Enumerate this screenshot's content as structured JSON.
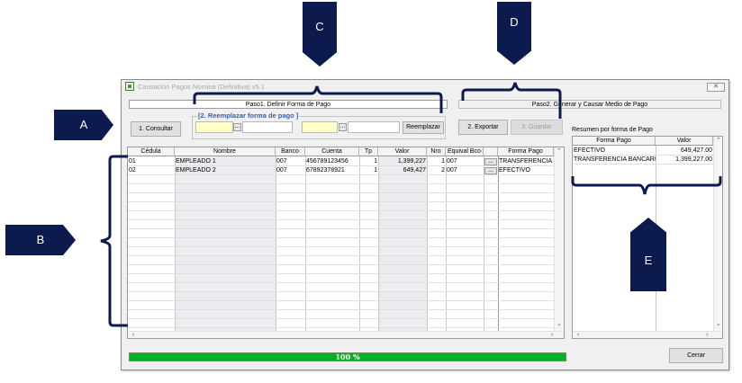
{
  "window": {
    "title": "Causación Pagos Nomina (Definitiva) v5.1",
    "close_label": "✕"
  },
  "panel1": {
    "title": "Paso1. Definir Forma de Pago",
    "consult_button": "1. Consultar",
    "group_label": "[2. Reemplazar forma de pago ]",
    "dots_label": "...",
    "replace_button": "Reemplazar"
  },
  "panel2": {
    "title": "Paso2. Generar y Causar Medio de Pago",
    "export_button": "2. Exportar",
    "save_button": "3. Guardar",
    "summary_label": "Resumen por forma de Pago"
  },
  "main_grid": {
    "columns": [
      "Cédula",
      "Nombre",
      "Banco",
      "Cuenta",
      "Tp",
      "Valor",
      "Nro",
      "Equival Bco",
      "",
      "Forma Pago"
    ],
    "rows": [
      {
        "cedula": "01",
        "nombre": "EMPLEADO 1",
        "banco": "007",
        "cuenta": "456789123456",
        "tp": "1",
        "valor": "1,399,227",
        "nro": "1",
        "equival": "007",
        "btn": "...",
        "forma": "TRANSFERENCIA BANCARIA"
      },
      {
        "cedula": "02",
        "nombre": "EMPLEADO 2",
        "banco": "007",
        "cuenta": "67892378921",
        "tp": "1",
        "valor": "649,427",
        "nro": "2",
        "equival": "007",
        "btn": "...",
        "forma": "EFECTIVO"
      }
    ]
  },
  "summary_grid": {
    "columns": [
      "Forma Pago",
      "Valor"
    ],
    "rows": [
      {
        "forma": "EFECTIVO",
        "valor": "649,427.00"
      },
      {
        "forma": "TRANSFERENCIA BANCARIA",
        "valor": "1,399,227.00"
      }
    ]
  },
  "progress": {
    "value": 100,
    "label": "100 %"
  },
  "close_button": "Cerrar",
  "callouts": {
    "a": "A",
    "b": "B",
    "c": "C",
    "d": "D",
    "e": "E"
  },
  "colors": {
    "callout": "#0d1a4d",
    "progress": "#06b025",
    "group_label": "#3b5fa7",
    "input_yellow": "#ffffc8"
  }
}
